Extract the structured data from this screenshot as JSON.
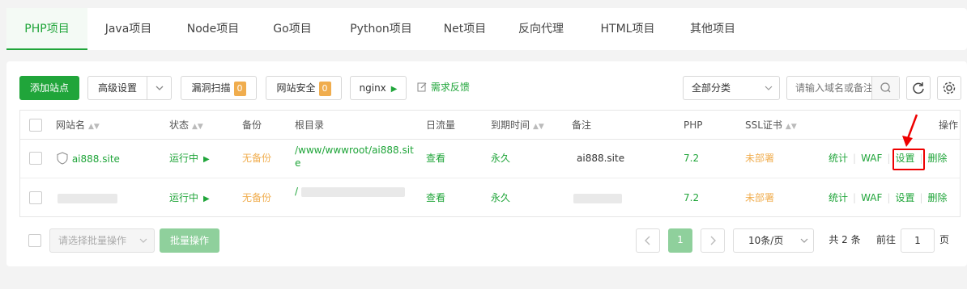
{
  "tabs": [
    "PHP项目",
    "Java项目",
    "Node项目",
    "Go项目",
    "Python项目",
    "Net项目",
    "反向代理",
    "HTML项目",
    "其他项目"
  ],
  "toolbar": {
    "add_site": "添加站点",
    "advanced": "高级设置",
    "vuln_scan": "漏洞扫描",
    "vuln_count": "0",
    "site_security": "网站安全",
    "security_count": "0",
    "nginx": "nginx",
    "feedback": "需求反馈",
    "category": "全部分类",
    "search_placeholder": "请输入域名或备注"
  },
  "columns": {
    "name": "网站名",
    "status": "状态",
    "backup": "备份",
    "root": "根目录",
    "traffic": "日流量",
    "expire": "到期时间",
    "remark": "备注",
    "php": "PHP",
    "ssl": "SSL证书",
    "ops": "操作"
  },
  "rows": [
    {
      "name": "ai888.site",
      "status": "运行中",
      "backup": "无备份",
      "root_line1": "/www/wwwroot/ai888.sit",
      "root_line2": "e",
      "traffic": "查看",
      "expire": "永久",
      "remark": "ai888.site",
      "php": "7.2",
      "ssl": "未部署",
      "ops": [
        "统计",
        "WAF",
        "设置",
        "删除"
      ]
    },
    {
      "name": "",
      "status": "运行中",
      "backup": "无备份",
      "root_line1": "/",
      "root_line2": "",
      "traffic": "查看",
      "expire": "永久",
      "remark": "",
      "php": "7.2",
      "ssl": "未部署",
      "ops": [
        "统计",
        "WAF",
        "设置",
        "删除"
      ]
    }
  ],
  "footer": {
    "batch_placeholder": "请选择批量操作",
    "batch_button": "批量操作",
    "page": "1",
    "page_size": "10条/页",
    "total": "共 2 条",
    "goto_label": "前往",
    "goto_value": "1",
    "page_unit": "页"
  },
  "colors": {
    "accent": "#20a53a",
    "warning": "#f0ad4e",
    "highlight": "#e00000"
  }
}
